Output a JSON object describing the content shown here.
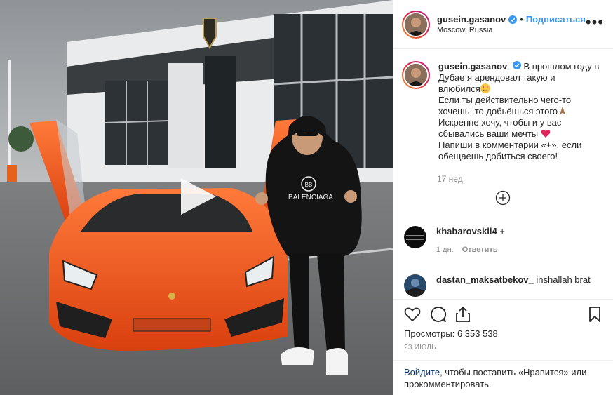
{
  "post": {
    "author": {
      "username": "gusein.gasanov",
      "location": "Moscow, Russia",
      "follow_label": "Подписаться",
      "dot": "•",
      "more_label": "•••"
    },
    "caption": {
      "username": "gusein.gasanov",
      "lines": [
        "В прошлом году в",
        "Дубае я арендовал такую и",
        "влюбился",
        "Если ты действительно чего-то",
        "хочешь, то добьёшься этого",
        "Искренне хочу, чтобы и у вас",
        "сбывались ваши мечты",
        "Напиши в комментарии «+», если",
        "обещаешь добиться своего!"
      ],
      "time_ago": "17 нед."
    },
    "comments": [
      {
        "username": "khabarovskii4",
        "text": "+",
        "time": "1 дн.",
        "reply_label": "Ответить"
      },
      {
        "username": "dastan_maksatbekov_",
        "text": "inshallah brat"
      }
    ],
    "stats": {
      "views_label": "Просмотры:",
      "views_count": "6 353 538",
      "date": "23 ИЮЛЬ"
    },
    "login_prompt": {
      "link": "Войдите",
      "rest": ", чтобы поставить «Нравится» или прокомментировать."
    },
    "media": {
      "hoodie_text": "BALENCIAGA",
      "hoodie_logo": "BB"
    },
    "icons": [
      "play-icon",
      "verified-icon",
      "more-icon",
      "heart-icon",
      "comment-icon",
      "share-icon",
      "bookmark-icon",
      "plus-circle-icon"
    ],
    "colors": {
      "link": "#3897f0",
      "car": "#f2561d",
      "muted": "#8e8e8e"
    }
  }
}
